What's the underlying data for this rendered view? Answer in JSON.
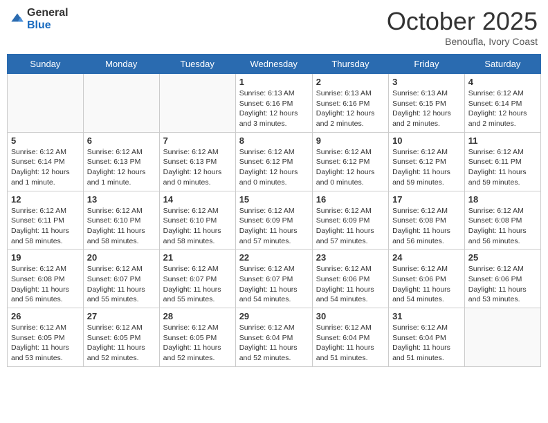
{
  "header": {
    "logo_general": "General",
    "logo_blue": "Blue",
    "month": "October 2025",
    "location": "Benoufla, Ivory Coast"
  },
  "weekdays": [
    "Sunday",
    "Monday",
    "Tuesday",
    "Wednesday",
    "Thursday",
    "Friday",
    "Saturday"
  ],
  "weeks": [
    [
      {
        "day": "",
        "info": ""
      },
      {
        "day": "",
        "info": ""
      },
      {
        "day": "",
        "info": ""
      },
      {
        "day": "1",
        "info": "Sunrise: 6:13 AM\nSunset: 6:16 PM\nDaylight: 12 hours and 3 minutes."
      },
      {
        "day": "2",
        "info": "Sunrise: 6:13 AM\nSunset: 6:16 PM\nDaylight: 12 hours and 2 minutes."
      },
      {
        "day": "3",
        "info": "Sunrise: 6:13 AM\nSunset: 6:15 PM\nDaylight: 12 hours and 2 minutes."
      },
      {
        "day": "4",
        "info": "Sunrise: 6:12 AM\nSunset: 6:14 PM\nDaylight: 12 hours and 2 minutes."
      }
    ],
    [
      {
        "day": "5",
        "info": "Sunrise: 6:12 AM\nSunset: 6:14 PM\nDaylight: 12 hours and 1 minute."
      },
      {
        "day": "6",
        "info": "Sunrise: 6:12 AM\nSunset: 6:13 PM\nDaylight: 12 hours and 1 minute."
      },
      {
        "day": "7",
        "info": "Sunrise: 6:12 AM\nSunset: 6:13 PM\nDaylight: 12 hours and 0 minutes."
      },
      {
        "day": "8",
        "info": "Sunrise: 6:12 AM\nSunset: 6:12 PM\nDaylight: 12 hours and 0 minutes."
      },
      {
        "day": "9",
        "info": "Sunrise: 6:12 AM\nSunset: 6:12 PM\nDaylight: 12 hours and 0 minutes."
      },
      {
        "day": "10",
        "info": "Sunrise: 6:12 AM\nSunset: 6:12 PM\nDaylight: 11 hours and 59 minutes."
      },
      {
        "day": "11",
        "info": "Sunrise: 6:12 AM\nSunset: 6:11 PM\nDaylight: 11 hours and 59 minutes."
      }
    ],
    [
      {
        "day": "12",
        "info": "Sunrise: 6:12 AM\nSunset: 6:11 PM\nDaylight: 11 hours and 58 minutes."
      },
      {
        "day": "13",
        "info": "Sunrise: 6:12 AM\nSunset: 6:10 PM\nDaylight: 11 hours and 58 minutes."
      },
      {
        "day": "14",
        "info": "Sunrise: 6:12 AM\nSunset: 6:10 PM\nDaylight: 11 hours and 58 minutes."
      },
      {
        "day": "15",
        "info": "Sunrise: 6:12 AM\nSunset: 6:09 PM\nDaylight: 11 hours and 57 minutes."
      },
      {
        "day": "16",
        "info": "Sunrise: 6:12 AM\nSunset: 6:09 PM\nDaylight: 11 hours and 57 minutes."
      },
      {
        "day": "17",
        "info": "Sunrise: 6:12 AM\nSunset: 6:08 PM\nDaylight: 11 hours and 56 minutes."
      },
      {
        "day": "18",
        "info": "Sunrise: 6:12 AM\nSunset: 6:08 PM\nDaylight: 11 hours and 56 minutes."
      }
    ],
    [
      {
        "day": "19",
        "info": "Sunrise: 6:12 AM\nSunset: 6:08 PM\nDaylight: 11 hours and 56 minutes."
      },
      {
        "day": "20",
        "info": "Sunrise: 6:12 AM\nSunset: 6:07 PM\nDaylight: 11 hours and 55 minutes."
      },
      {
        "day": "21",
        "info": "Sunrise: 6:12 AM\nSunset: 6:07 PM\nDaylight: 11 hours and 55 minutes."
      },
      {
        "day": "22",
        "info": "Sunrise: 6:12 AM\nSunset: 6:07 PM\nDaylight: 11 hours and 54 minutes."
      },
      {
        "day": "23",
        "info": "Sunrise: 6:12 AM\nSunset: 6:06 PM\nDaylight: 11 hours and 54 minutes."
      },
      {
        "day": "24",
        "info": "Sunrise: 6:12 AM\nSunset: 6:06 PM\nDaylight: 11 hours and 54 minutes."
      },
      {
        "day": "25",
        "info": "Sunrise: 6:12 AM\nSunset: 6:06 PM\nDaylight: 11 hours and 53 minutes."
      }
    ],
    [
      {
        "day": "26",
        "info": "Sunrise: 6:12 AM\nSunset: 6:05 PM\nDaylight: 11 hours and 53 minutes."
      },
      {
        "day": "27",
        "info": "Sunrise: 6:12 AM\nSunset: 6:05 PM\nDaylight: 11 hours and 52 minutes."
      },
      {
        "day": "28",
        "info": "Sunrise: 6:12 AM\nSunset: 6:05 PM\nDaylight: 11 hours and 52 minutes."
      },
      {
        "day": "29",
        "info": "Sunrise: 6:12 AM\nSunset: 6:04 PM\nDaylight: 11 hours and 52 minutes."
      },
      {
        "day": "30",
        "info": "Sunrise: 6:12 AM\nSunset: 6:04 PM\nDaylight: 11 hours and 51 minutes."
      },
      {
        "day": "31",
        "info": "Sunrise: 6:12 AM\nSunset: 6:04 PM\nDaylight: 11 hours and 51 minutes."
      },
      {
        "day": "",
        "info": ""
      }
    ]
  ]
}
